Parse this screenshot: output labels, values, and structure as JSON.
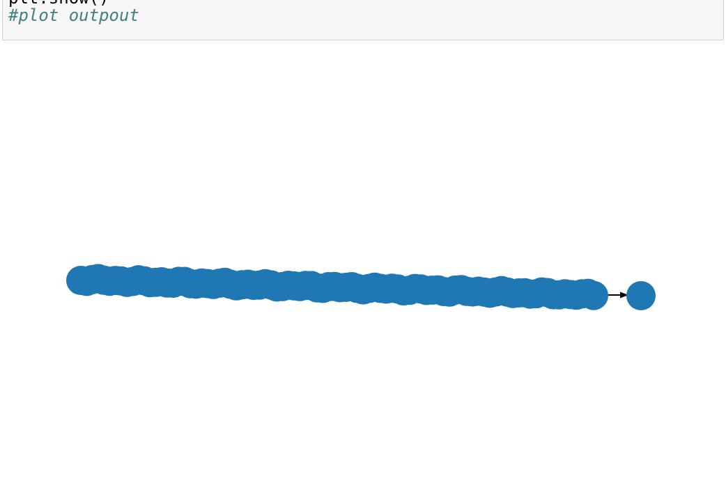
{
  "code_cell": {
    "previous_line": "plt.show()",
    "comment": "#plot outpout"
  },
  "plot": {
    "node_color": "#1f77b4",
    "edge_color": "#000000",
    "node_cluster_description": "dense chain of overlapping nodes",
    "isolated_target_node": true,
    "edge_arrow": "directed"
  }
}
